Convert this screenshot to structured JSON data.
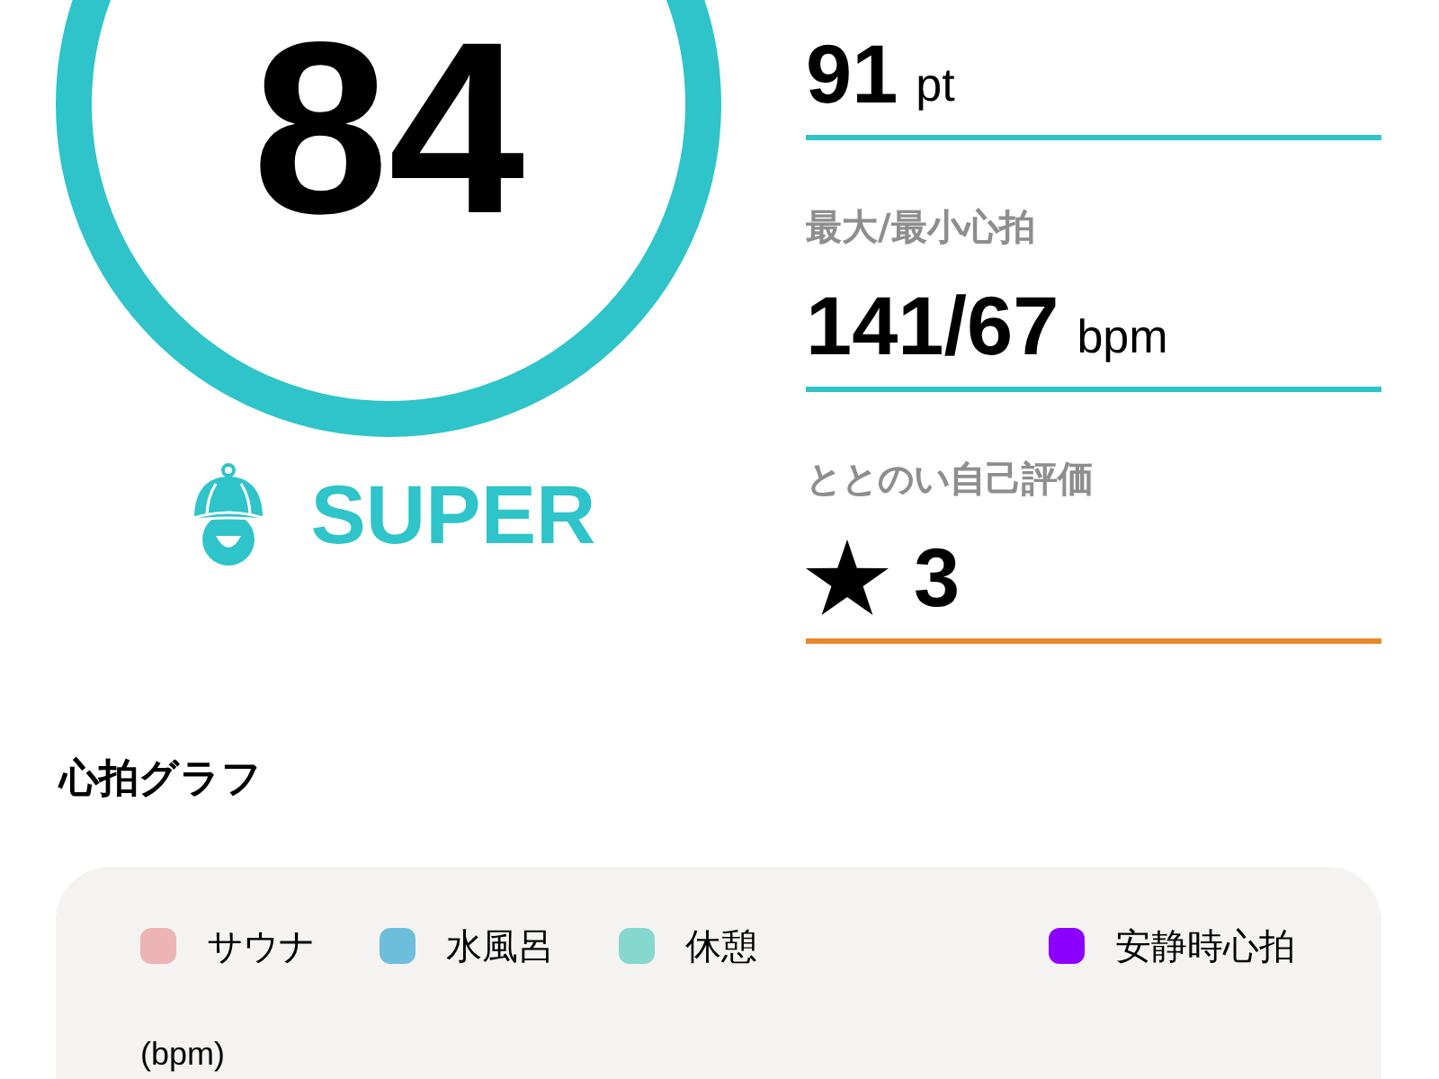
{
  "score": {
    "value": "84",
    "rank": "SUPER"
  },
  "metrics": [
    {
      "kind": "value",
      "value": "91",
      "unit": "pt",
      "color": "#2ec4c9"
    },
    {
      "kind": "value",
      "label": "最大/最小心拍",
      "value": "141/67",
      "unit": "bpm",
      "color": "#2ec4c9"
    },
    {
      "kind": "rating",
      "label": "ととのい自己評価",
      "value": "3",
      "color": "#e8862a"
    }
  ],
  "heart_rate_chart": {
    "title": "心拍グラフ",
    "legend": [
      {
        "label": "サウナ",
        "color": "#ecb4b4"
      },
      {
        "label": "水風呂",
        "color": "#6cbedb"
      },
      {
        "label": "休憩",
        "color": "#86d7cd"
      },
      {
        "label": "安静時心拍",
        "color": "#8b00ff"
      }
    ],
    "y_unit": "(bpm)"
  }
}
